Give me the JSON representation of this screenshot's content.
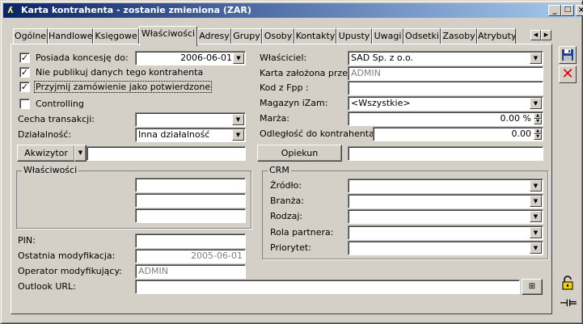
{
  "window": {
    "title": "Karta kontrahenta - zostanie zmieniona (ZAR)",
    "minimize": "_",
    "maximize": "□",
    "close": "×"
  },
  "tabs": [
    "Ogólne",
    "Handlowe",
    "Księgowe",
    "Właściwości",
    "Adresy",
    "Grupy",
    "Osoby",
    "Kontakty",
    "Upusty",
    "Uwagi",
    "Odsetki",
    "Zasoby",
    "Atrybuty"
  ],
  "active_tab": "Właściwości",
  "left": {
    "posiada_koncesje_label": "Posiada koncesję do:",
    "posiada_koncesje_checked": true,
    "koncesja_date": "2006-06-01",
    "nie_publikuj_label": "Nie publikuj danych tego kontrahenta",
    "nie_publikuj_checked": true,
    "przyjmij_label": "Przyjmij zamówienie jako potwierdzone",
    "przyjmij_checked": true,
    "controlling_label": "Controlling",
    "controlling_checked": false,
    "cecha_label": "Cecha transakcji:",
    "cecha_value": "",
    "dzialalnosc_label": "Działalność:",
    "dzialalnosc_value": "Inna działalność",
    "akwizytor_label": "Akwizytor",
    "akwizytor_value": "",
    "wlasciwosci_group": "Właściwości",
    "pin_label": "PIN:",
    "pin_value": "",
    "ostatnia_mod_label": "Ostatnia modyfikacja:",
    "ostatnia_mod_value": "2005-06-01",
    "operator_label": "Operator modyfikujący:",
    "operator_value": "ADMIN",
    "outlook_label": "Outlook URL:",
    "outlook_value": ""
  },
  "right": {
    "wlasciciel_label": "Właściciel:",
    "wlasciciel_value": "SAD Sp. z o.o.",
    "karta_zalozona_label": "Karta założona przez:",
    "karta_zalozona_value": "ADMIN",
    "kod_fpp_label": "Kod z Fpp :",
    "kod_fpp_value": "",
    "magazyn_label": "Magazyn iZam:",
    "magazyn_value": "<Wszystkie>",
    "marza_label": "Marża:",
    "marza_value": "0.00 %",
    "odleglosc_label": "Odległość do kontrahenta:",
    "odleglosc_value": "0.00",
    "opiekun_label": "Opiekun",
    "opiekun_value": "",
    "crm_group": "CRM",
    "zrodlo_label": "Źródło:",
    "branza_label": "Branża:",
    "rodzaj_label": "Rodzaj:",
    "rola_label": "Rola partnera:",
    "priorytet_label": "Priorytet:"
  },
  "icons": {
    "save": "save-icon",
    "cancel": "cancel-icon",
    "lock": "lock-icon",
    "pin": "pin-icon"
  }
}
